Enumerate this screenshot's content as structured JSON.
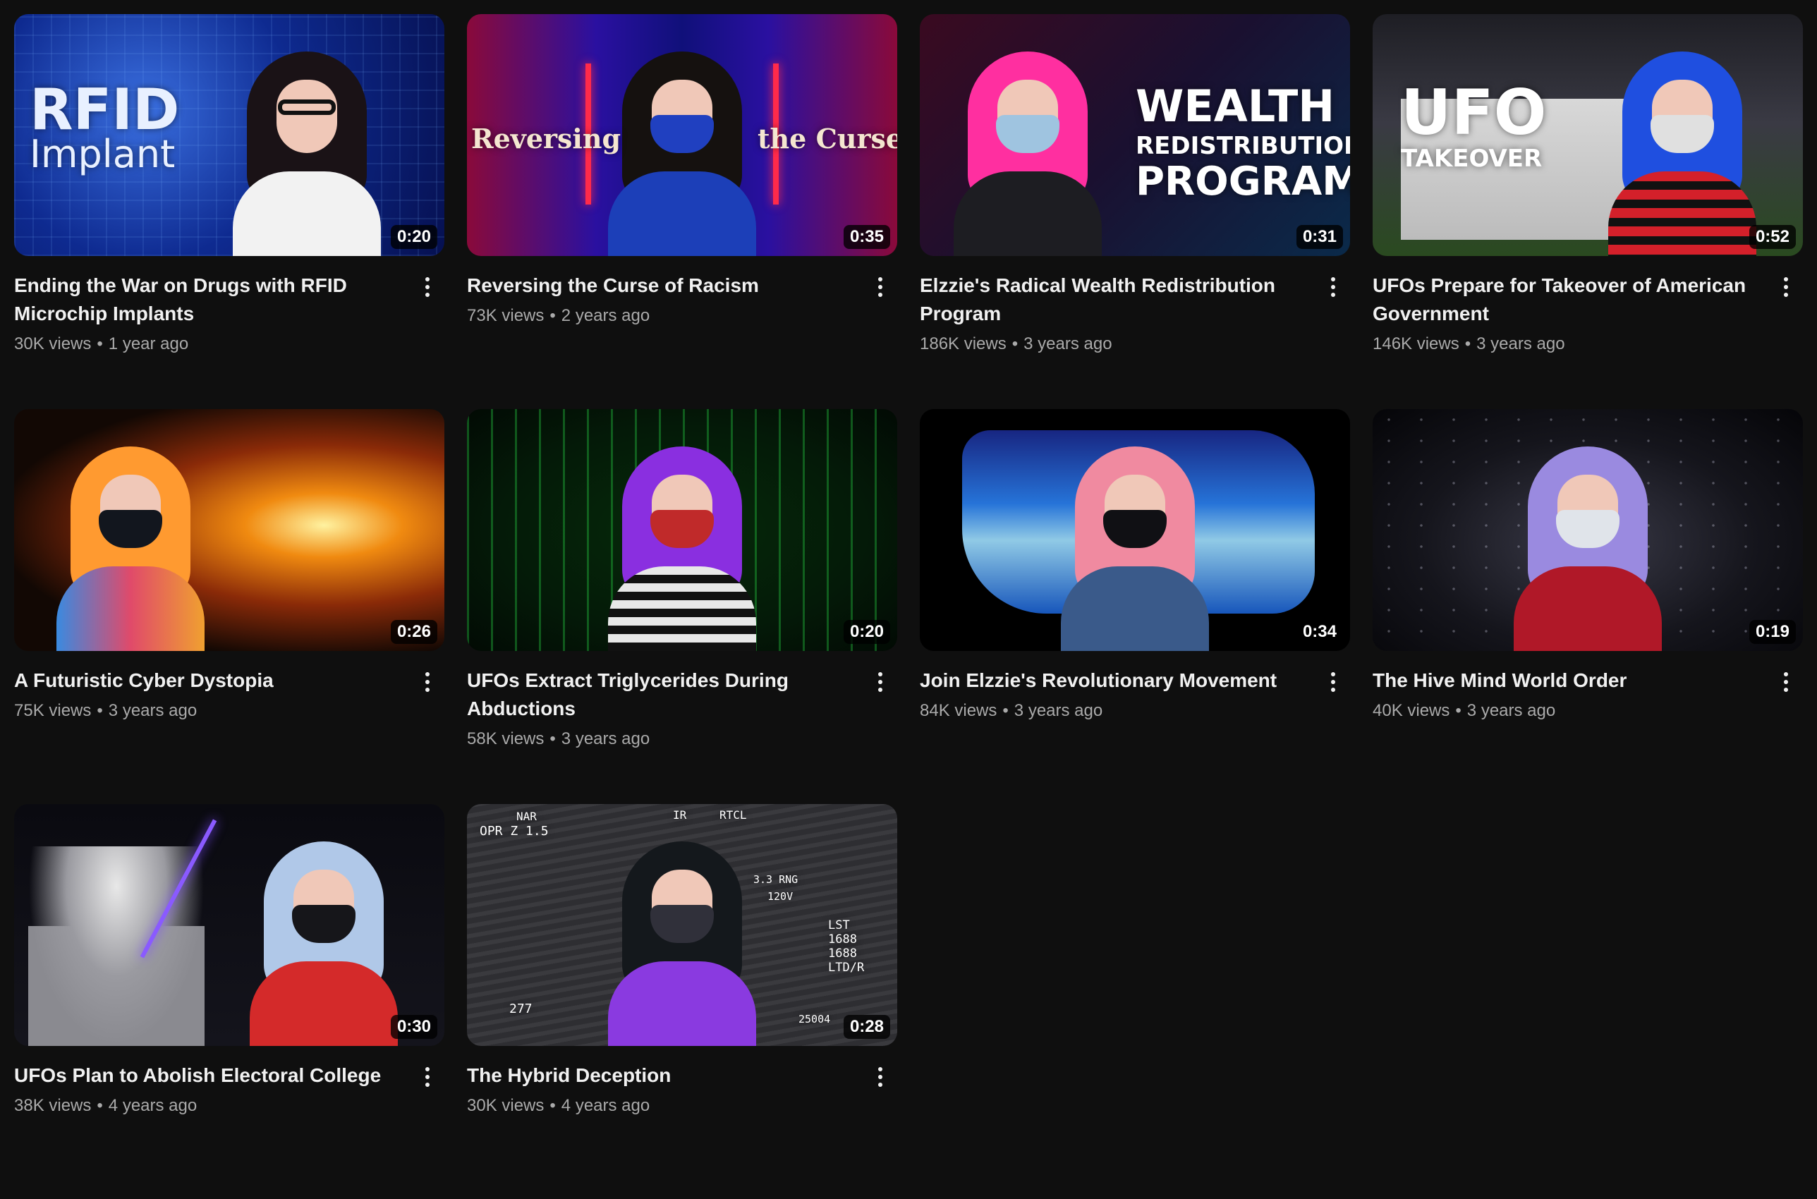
{
  "videos": [
    {
      "title": "Ending the War on Drugs with RFID Microchip Implants",
      "views": "30K views",
      "age": "1 year ago",
      "duration": "0:20",
      "thumb_text": [
        "RFID",
        "Implant"
      ],
      "colors": {
        "bg1": "#0a1a6a",
        "bg2": "#3a6fe0",
        "hair": "#1a1216",
        "mask": "#f0c8b8",
        "body": "#f2f2f2"
      }
    },
    {
      "title": "Reversing the Curse of Racism",
      "views": "73K views",
      "age": "2 years ago",
      "duration": "0:35",
      "thumb_text": [
        "Reversing",
        "the Curse"
      ],
      "colors": {
        "bg1": "#6a0a2a",
        "bg2": "#1a28c8",
        "hair": "#15110f",
        "mask": "#2040c0",
        "body": "#1c3fb8"
      }
    },
    {
      "title": "Elzzie's Radical Wealth Redistribution Program",
      "views": "186K views",
      "age": "3 years ago",
      "duration": "0:31",
      "thumb_text": [
        "WEALTH",
        "REDISTRIBUTION",
        "PROGRAM"
      ],
      "colors": {
        "bg1": "#2a0a1a",
        "bg2": "#d02060",
        "hair": "#ff2fa0",
        "mask": "#9fc4e0",
        "body": "#1d1d22"
      }
    },
    {
      "title": "UFOs Prepare for Takeover of American Government",
      "views": "146K views",
      "age": "3 years ago",
      "duration": "0:52",
      "thumb_text": [
        "UFO",
        "TAKEOVER"
      ],
      "colors": {
        "bg1": "#1c1c22",
        "bg2": "#c8c8c8",
        "hair": "#1f4fe0",
        "mask": "#e0e0e0",
        "body": "#d4202a"
      }
    },
    {
      "title": "A Futuristic Cyber Dystopia",
      "views": "75K views",
      "age": "3 years ago",
      "duration": "0:26",
      "thumb_text": [],
      "colors": {
        "bg1": "#120804",
        "bg2": "#f08a10",
        "hair": "#ff9a30",
        "mask": "#12161e",
        "body": "#e04a6a"
      }
    },
    {
      "title": "UFOs Extract Triglycerides During Abductions",
      "views": "58K views",
      "age": "3 years ago",
      "duration": "0:20",
      "thumb_text": [],
      "colors": {
        "bg1": "#041a08",
        "bg2": "#24d040",
        "hair": "#8a2fe0",
        "mask": "#c02a2a",
        "body": "#e8e8e8"
      }
    },
    {
      "title": "Join Elzzie's Revolutionary Movement",
      "views": "84K views",
      "age": "3 years ago",
      "duration": "0:34",
      "thumb_text": [],
      "colors": {
        "bg1": "#000000",
        "bg2": "#1a60d0",
        "hair": "#f08aa0",
        "mask": "#101014",
        "body": "#3a5a8a"
      }
    },
    {
      "title": "The Hive Mind World Order",
      "views": "40K views",
      "age": "3 years ago",
      "duration": "0:19",
      "thumb_text": [],
      "colors": {
        "bg1": "#050508",
        "bg2": "#3a3a48",
        "hair": "#9a8ae0",
        "mask": "#e0e4ea",
        "body": "#b01828"
      }
    },
    {
      "title": "UFOs Plan to Abolish Electoral College",
      "views": "38K views",
      "age": "4 years ago",
      "duration": "0:30",
      "thumb_text": [],
      "colors": {
        "bg1": "#08080a",
        "bg2": "#5a2ae0",
        "hair": "#b0c8e8",
        "mask": "#16161a",
        "body": "#d42a2a"
      }
    },
    {
      "title": "The Hybrid Deception",
      "views": "30K views",
      "age": "4 years ago",
      "duration": "0:28",
      "thumb_text": [
        "NAR",
        "OPR Z 1.5",
        "IR",
        "RTCL",
        "3.3 RNG",
        "120V",
        "LST",
        "1688",
        "1688",
        "LTD/R",
        "277",
        "25004"
      ],
      "colors": {
        "bg1": "#2a2a2c",
        "bg2": "#5a5a5e",
        "hair": "#14181c",
        "mask": "#30303a",
        "body": "#8a3ae0"
      }
    }
  ],
  "separator": "•",
  "icons": {
    "menu": "more-vert-icon"
  }
}
